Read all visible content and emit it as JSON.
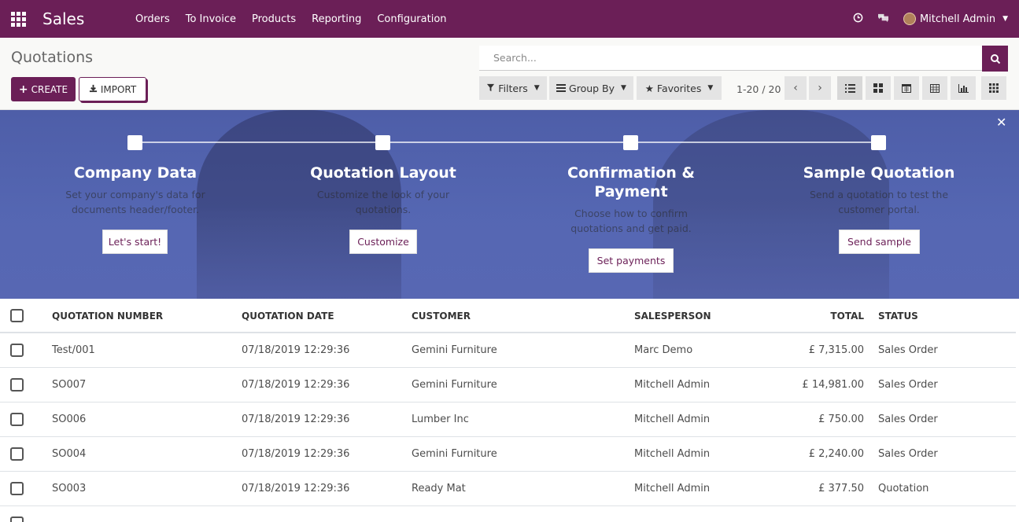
{
  "navbar": {
    "app_name": "Sales",
    "menu": [
      "Orders",
      "To Invoice",
      "Products",
      "Reporting",
      "Configuration"
    ],
    "user": "Mitchell Admin",
    "icons": [
      "apps-grid-icon",
      "clock-icon",
      "chat-icon"
    ]
  },
  "control_panel": {
    "title": "Quotations",
    "create_label": "CREATE",
    "import_label": "IMPORT",
    "search_placeholder": "Search...",
    "filters_label": "Filters",
    "groupby_label": "Group By",
    "favorites_label": "Favorites",
    "pager": "1-20 / 20",
    "views": [
      "list-view-icon",
      "kanban-view-icon",
      "calendar-view-icon",
      "pivot-view-icon",
      "graph-view-icon",
      "activity-view-icon"
    ]
  },
  "onboarding": {
    "steps": [
      {
        "title": "Company Data",
        "desc": "Set your company's data for documents header/footer.",
        "button": "Let's start!"
      },
      {
        "title": "Quotation Layout",
        "desc": "Customize the look of your quotations.",
        "button": "Customize"
      },
      {
        "title": "Confirmation & Payment",
        "desc": "Choose how to confirm quotations and get paid.",
        "button": "Set payments"
      },
      {
        "title": "Sample Quotation",
        "desc": "Send a quotation to test the customer portal.",
        "button": "Send sample"
      }
    ]
  },
  "table": {
    "headers": {
      "number": "QUOTATION NUMBER",
      "date": "QUOTATION DATE",
      "customer": "CUSTOMER",
      "salesperson": "SALESPERSON",
      "total": "TOTAL",
      "status": "STATUS"
    },
    "rows": [
      {
        "number": "Test/001",
        "date": "07/18/2019 12:29:36",
        "customer": "Gemini Furniture",
        "salesperson": "Marc Demo",
        "total": "£ 7,315.00",
        "status": "Sales Order"
      },
      {
        "number": "SO007",
        "date": "07/18/2019 12:29:36",
        "customer": "Gemini Furniture",
        "salesperson": "Mitchell Admin",
        "total": "£ 14,981.00",
        "status": "Sales Order"
      },
      {
        "number": "SO006",
        "date": "07/18/2019 12:29:36",
        "customer": "Lumber Inc",
        "salesperson": "Mitchell Admin",
        "total": "£ 750.00",
        "status": "Sales Order"
      },
      {
        "number": "SO004",
        "date": "07/18/2019 12:29:36",
        "customer": "Gemini Furniture",
        "salesperson": "Mitchell Admin",
        "total": "£ 2,240.00",
        "status": "Sales Order"
      },
      {
        "number": "SO003",
        "date": "07/18/2019 12:29:36",
        "customer": "Ready Mat",
        "salesperson": "Mitchell Admin",
        "total": "£ 377.50",
        "status": "Quotation"
      }
    ]
  }
}
